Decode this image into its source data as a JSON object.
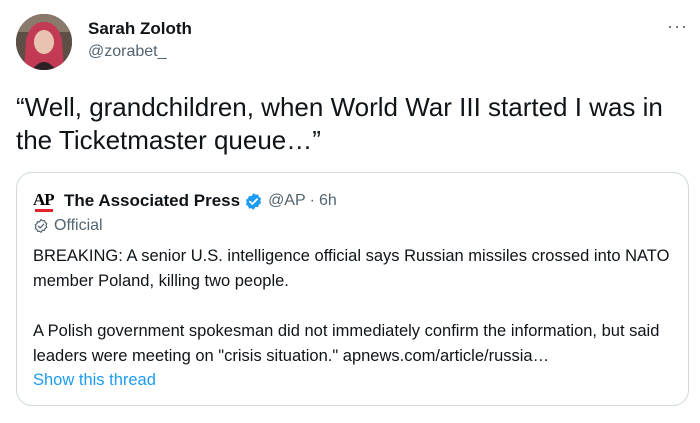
{
  "tweet": {
    "author_name": "Sarah Zoloth",
    "author_handle": "@zorabet_",
    "text": "“Well, grandchildren, when World War III started I was in the Ticketmaster queue…”",
    "more_icon": "more-icon"
  },
  "quote": {
    "logo_text": "AP",
    "author_name": "The Associated Press",
    "verified_icon": "verified-badge-icon",
    "author_handle": "@AP",
    "separator": "·",
    "timestamp": "6h",
    "official_label": "Official",
    "paragraph_1": "BREAKING: A senior U.S. intelligence official says Russian missiles crossed into NATO member Poland, killing two people.",
    "paragraph_2": "A Polish government spokesman did not immediately confirm the information, but said leaders were meeting on \"crisis situation.\" apnews.com/article/russia…",
    "show_thread": "Show this thread"
  },
  "colors": {
    "text": "#0f1419",
    "secondary": "#536471",
    "link": "#1d9bf0",
    "border": "#cfd9de",
    "ap_red": "#e3232a"
  }
}
